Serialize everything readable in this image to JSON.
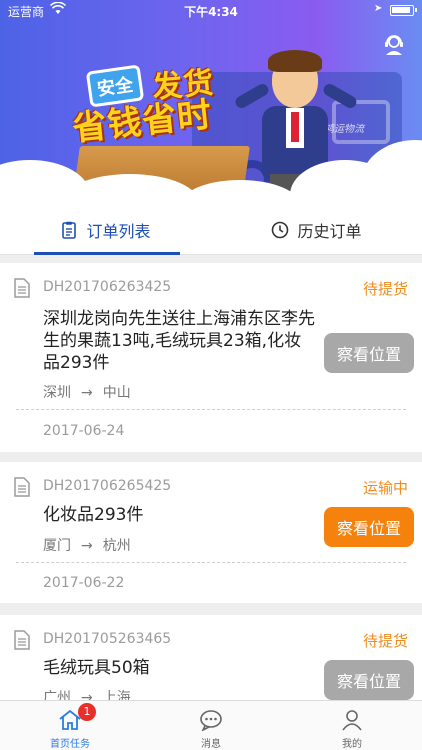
{
  "status_bar": {
    "carrier": "运营商",
    "time": "下午4:34"
  },
  "banner": {
    "tag": "安全",
    "headline_1": "发货",
    "headline_2": "省钱省时",
    "truck_brand": "鸿运物流"
  },
  "tabs": [
    {
      "label": "订单列表",
      "active": true,
      "icon": "clipboard-list-icon"
    },
    {
      "label": "历史订单",
      "active": false,
      "icon": "clock-icon"
    }
  ],
  "orders": [
    {
      "id": "DH201706263425",
      "status": "待提货",
      "description": "深圳龙岗向先生送往上海浦东区李先生的果蔬13吨,毛绒玩具23箱,化妆品293件",
      "from": "深圳",
      "to": "中山",
      "arrow": "→",
      "date": "2017-06-24",
      "button": "察看位置",
      "button_color": "#a8a8a8"
    },
    {
      "id": "DH201706265425",
      "status": "运输中",
      "description": "化妆品293件",
      "from": "厦门",
      "to": "杭州",
      "arrow": "→",
      "date": "2017-06-22",
      "button": "察看位置",
      "button_color": "#f5820c"
    },
    {
      "id": "DH201705263465",
      "status": "待提货",
      "description": "毛绒玩具50箱",
      "from": "广州",
      "to": "上海",
      "arrow": "→",
      "date": "",
      "button": "察看位置",
      "button_color": "#a8a8a8"
    }
  ],
  "bottom_nav": [
    {
      "label": "首页任务",
      "icon": "home-icon",
      "badge": "1",
      "active": true
    },
    {
      "label": "消息",
      "icon": "message-icon",
      "active": false
    },
    {
      "label": "我的",
      "icon": "user-icon",
      "active": false
    }
  ],
  "colors": {
    "accent": "#1e4fb6",
    "status": "#f08c1e",
    "nav_active": "#2a7de1"
  }
}
